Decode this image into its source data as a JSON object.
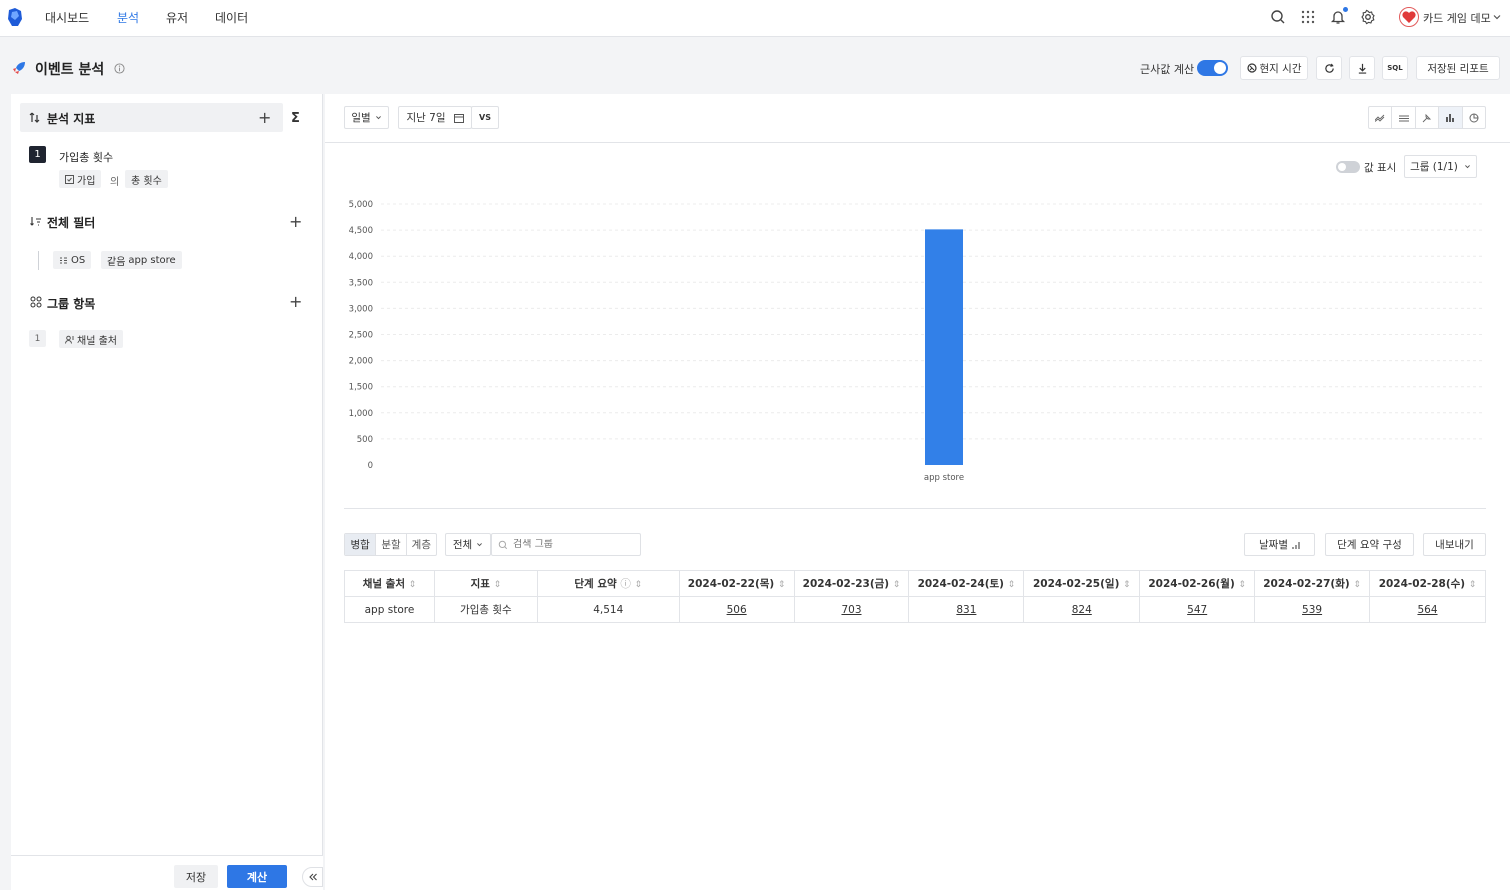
{
  "nav": {
    "items": [
      "대시보드",
      "분석",
      "유저",
      "데이터"
    ],
    "active": "분석",
    "project": "카드 게임 데모"
  },
  "header": {
    "title": "이벤트 분석",
    "approx_label": "근사값 계산",
    "approx_enabled": true,
    "local_time_label": "현지 시간",
    "sql_label": "SQL",
    "saved_reports_label": "저장된 리포트"
  },
  "left": {
    "metrics": {
      "title": "분석 지표",
      "items": [
        {
          "index": "1",
          "name": "가입총 횟수",
          "event": "가입",
          "of": "의",
          "measure": "총 횟수"
        }
      ]
    },
    "filters": {
      "title": "전체 필터",
      "items": [
        {
          "field": "OS",
          "op": "같음",
          "value": "app store"
        }
      ]
    },
    "groups": {
      "title": "그룹 항목",
      "items": [
        {
          "index": "1",
          "name": "채널 출처"
        }
      ]
    },
    "save_label": "저장",
    "calc_label": "계산"
  },
  "toolbar": {
    "interval": "일별",
    "range": "지난 7일",
    "vs": "VS",
    "show_values_label": "값 표시",
    "group_select": "그룹 (1/1)"
  },
  "chart_data": {
    "type": "bar",
    "categories": [
      "app store"
    ],
    "values": [
      4514
    ],
    "ylim": [
      0,
      5000
    ],
    "yticks": [
      "5,000",
      "4,500",
      "4,000",
      "3,500",
      "3,000",
      "2,500",
      "2,000",
      "1,500",
      "1,000",
      "500",
      "0"
    ],
    "bar_color": "#3280e8"
  },
  "table_toolbar": {
    "modes": [
      "병합",
      "분할",
      "계층"
    ],
    "active_mode": "병합",
    "scope": "전체",
    "search_placeholder": "검색 그룹",
    "by_date_label": "날짜별",
    "step_summary_label": "단계 요약 구성",
    "export_label": "내보내기"
  },
  "table": {
    "headers": [
      "채널 출처",
      "지표",
      "단계 요약",
      "2024-02-22(목)",
      "2024-02-23(금)",
      "2024-02-24(토)",
      "2024-02-25(일)",
      "2024-02-26(월)",
      "2024-02-27(화)",
      "2024-02-28(수)"
    ],
    "rows": [
      [
        "app store",
        "가입총 횟수",
        "4,514",
        "506",
        "703",
        "831",
        "824",
        "547",
        "539",
        "564"
      ]
    ]
  }
}
